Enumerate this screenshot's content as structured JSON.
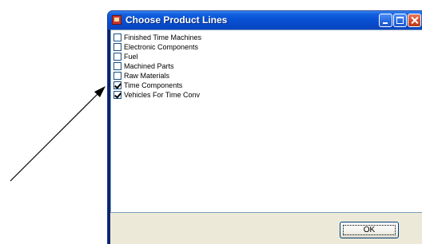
{
  "window": {
    "title": "Choose Product Lines",
    "app_icon": "app-icon",
    "controls": [
      "minimize-icon",
      "maximize-icon",
      "close-icon"
    ]
  },
  "product_lines": [
    {
      "label": "Finished Time Machines",
      "checked": false
    },
    {
      "label": "Electronic Components",
      "checked": false
    },
    {
      "label": "Fuel",
      "checked": false
    },
    {
      "label": "Machined Parts",
      "checked": false
    },
    {
      "label": "Raw Materials",
      "checked": false
    },
    {
      "label": "Time Components",
      "checked": true
    },
    {
      "label": "Vehicles For Time Conv",
      "checked": true
    }
  ],
  "ok_button": {
    "label": "OK"
  },
  "annotation": {
    "type": "arrow",
    "points_to": "product-line-list"
  },
  "colors": {
    "titlebar": "#0a53d6",
    "close_button": "#d24b27",
    "dialog_face": "#ece9d8"
  }
}
